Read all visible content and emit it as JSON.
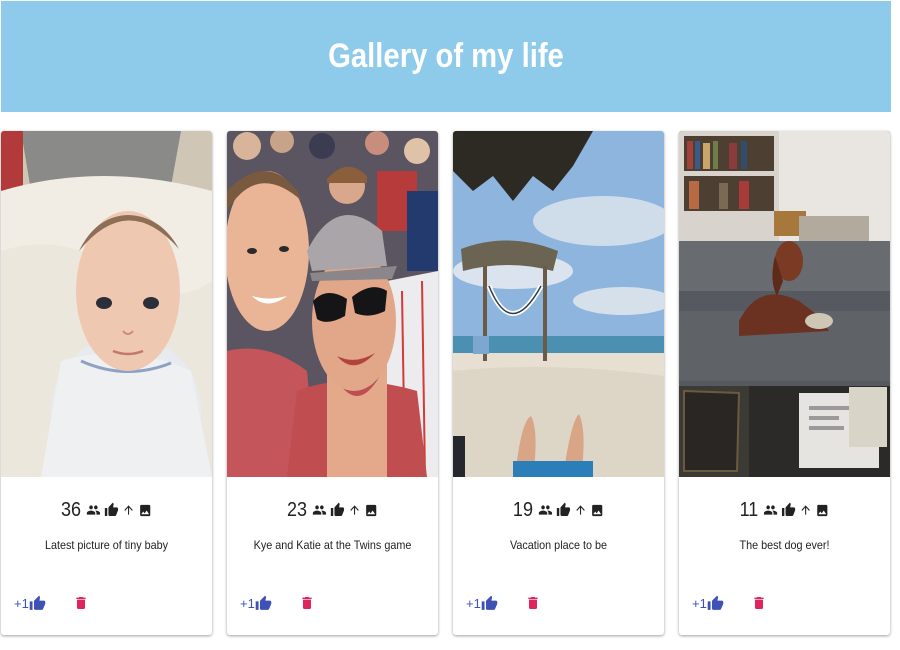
{
  "header": {
    "title": "Gallery of my life"
  },
  "colors": {
    "header_bg": "#8ecae9",
    "plus_one": "#3f51b5",
    "delete": "#e0245e"
  },
  "icons": [
    "people-icon",
    "thumb-up-icon",
    "arrow-up-icon",
    "image-icon",
    "thumb-up-icon",
    "delete-icon"
  ],
  "cards": [
    {
      "count": "36",
      "caption": "Latest picture of tiny baby",
      "plus_label": "+1"
    },
    {
      "count": "23",
      "caption": "Kye and Katie at the Twins game",
      "plus_label": "+1"
    },
    {
      "count": "19",
      "caption": "Vacation place to be",
      "plus_label": "+1"
    },
    {
      "count": "11",
      "caption": "The best dog ever!",
      "plus_label": "+1"
    }
  ]
}
